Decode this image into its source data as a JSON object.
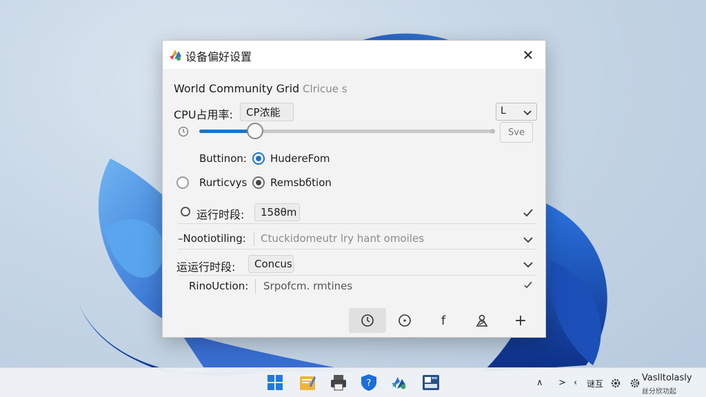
{
  "dialog": {
    "title": "设备偏好设置",
    "close_glyph": "✕",
    "project_name": "World Community Grid",
    "project_suffix": "Clricue s",
    "cpu_label": "CPU占用率:",
    "cpu_value": "CP浓能",
    "dropdown_glyph": "Ⅼ",
    "save_label": "Sve",
    "slider": {
      "value": 0.19
    },
    "radio_row1_label": "Buttinon:",
    "radio_row1_option": "HudereFom",
    "radio_row2_label": "Rurticvys",
    "radio_row2_option": "Remsbбtion",
    "row_runtime_label": "运行时段:",
    "row_runtime_value": "158θm",
    "row_notif_label": "–Nootiotiling:",
    "row_notif_placeholder": "Ctuckidomeutr lry hant omoiles",
    "row_runtime2_label": "运行时段:",
    "row_runtime2_prefix": "运",
    "row_runtime2_value": "Concus",
    "row_rino_label": "RinoUction:",
    "row_rino_value": "Srpofcm. rmtines",
    "toolbar_icons": [
      "clock-icon",
      "info-circle-icon",
      "facebook-icon",
      "person-location-icon",
      "plus-icon"
    ],
    "plus_glyph": "+",
    "f_glyph": "f"
  },
  "taskbar": {
    "tray_up": "∧",
    "tray_right": ">",
    "tray_small": "‹",
    "tray_label": "谜互",
    "clock_line1": "Vaslltolasly",
    "clock_line2": "丝分欣功起"
  },
  "colors": {
    "accent": "#1a73c9",
    "dialog_bg": "#f3f3f3",
    "taskbar_bg": "#eef2f7"
  }
}
